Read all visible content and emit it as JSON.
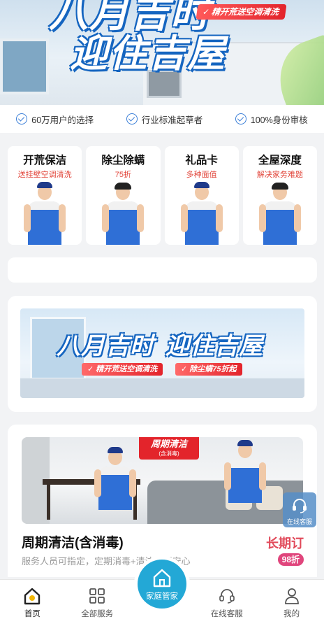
{
  "hero": {
    "title_line1": "八月吉时",
    "title_line2": "迎住吉屋",
    "tag": "精开荒送空调清洗"
  },
  "assurances": [
    {
      "label": "60万用户的选择"
    },
    {
      "label": "行业标准起草者"
    },
    {
      "label": "100%身份审核"
    }
  ],
  "services": [
    {
      "title": "开荒保洁",
      "subtitle": "送挂壁空调清洗"
    },
    {
      "title": "除尘除螨",
      "subtitle": "75折"
    },
    {
      "title": "礼品卡",
      "subtitle": "多种面值"
    },
    {
      "title": "全屋深度",
      "subtitle": "解决家务难题"
    }
  ],
  "promo": {
    "title_a": "八月吉时",
    "title_b": "迎住吉屋",
    "tag1": "精开荒送空调清洗",
    "tag2": "除尘螨75折起"
  },
  "periodic": {
    "badge_main": "周期清洁",
    "badge_sub": "(含消毒)",
    "name": "周期清洁(含消毒)",
    "desc": "服务人员可指定，定期消毒+清洁，更安心",
    "label": "长期订",
    "discount": "98折"
  },
  "float_service": {
    "label": "在线客服"
  },
  "tabbar": {
    "tabs": [
      {
        "label": "首页",
        "icon": "home-logo-icon"
      },
      {
        "label": "全部服务",
        "icon": "grid-icon"
      },
      {
        "label": "",
        "icon": ""
      },
      {
        "label": "在线客服",
        "icon": "headset-icon"
      },
      {
        "label": "我的",
        "icon": "user-icon"
      }
    ],
    "center": {
      "label": "家庭管家",
      "icon": "house-icon"
    }
  },
  "colors": {
    "accent": "#23a8d6",
    "brand_blue": "#1565c0",
    "red": "#e3242b",
    "pink": "#e0457c"
  }
}
